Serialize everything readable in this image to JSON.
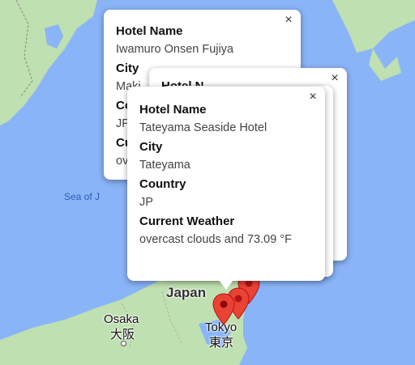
{
  "map": {
    "labels": {
      "sea_of_japan": "Sea of J",
      "country_japan": "Japan",
      "city_osaka": "Osaka",
      "city_osaka_jp": "大阪",
      "city_tokyo": "Tokyo",
      "city_tokyo_jp": "東京"
    },
    "colors": {
      "water": "#8ab4f8",
      "land": "#bfe0b0",
      "marker": "#ea4335"
    }
  },
  "info_windows": {
    "back": {
      "field1_label": "Hotel Name",
      "field1_value": "Iwamuro Onsen Fujiya",
      "field2_label": "City",
      "field2_value": "Maki",
      "field3_label": "Co",
      "field3_value": "JP",
      "field4_label": "Cu",
      "field4_value": "ov"
    },
    "middle": {
      "field1_label": "Hotel N"
    },
    "front": {
      "field1_label": "Hotel Name",
      "field1_value": "Tateyama Seaside Hotel",
      "field2_label": "City",
      "field2_value": "Tateyama",
      "field3_label": "Country",
      "field3_value": "JP",
      "field4_label": "Current Weather",
      "field4_value": "overcast clouds and 73.09 °F"
    },
    "close_glyph": "×"
  }
}
